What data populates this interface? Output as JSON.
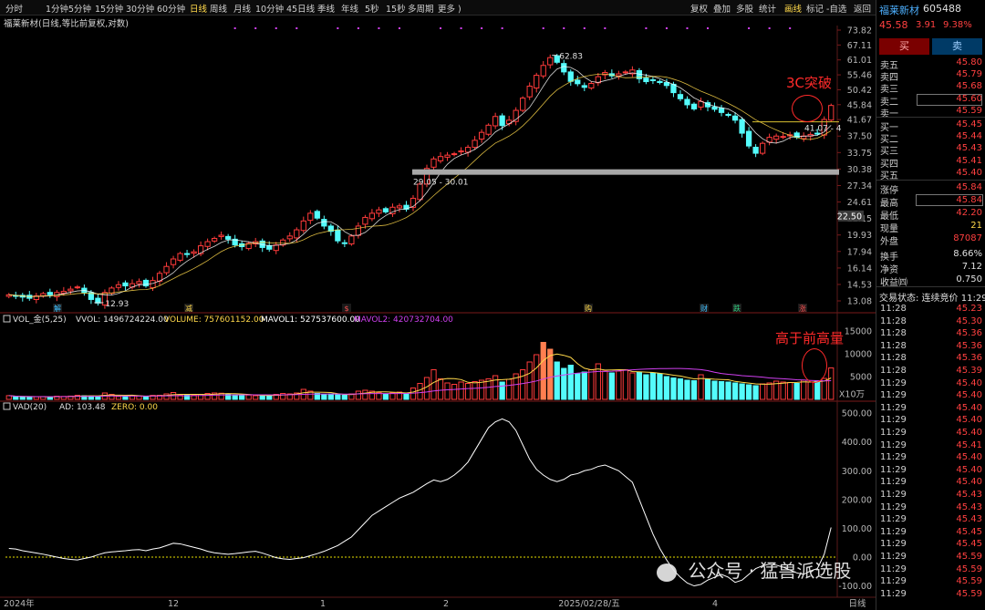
{
  "toolbar": {
    "periods": [
      "分时",
      "1分钟",
      "5分钟",
      "15分钟",
      "30分钟",
      "60分钟",
      "日线",
      "周线",
      "月线",
      "10分钟",
      "45日线",
      "季线",
      "年线",
      "5秒",
      "15秒",
      "多周期",
      "更多 )"
    ],
    "active": "日线",
    "right_items": [
      "复权",
      "叠加",
      "多股",
      "统计",
      "画线",
      "标记",
      "-自选",
      "返回"
    ],
    "active_right": "画线"
  },
  "chart_title": "福莱新材(日线,等比前复权,对数)",
  "colors": {
    "up": "#ff3b3b",
    "down": "#54fcfc",
    "ma5": "#ffffff",
    "ma10": "#ffd84a",
    "vol_ma1": "#ffd84a",
    "vol_ma2": "#d040f0",
    "vad": "#ffffff",
    "zero": "#e8e000"
  },
  "chart_data": [
    {
      "type": "candlestick",
      "y_scale": "log",
      "y_ticks": [
        "73.82",
        "67.11",
        "61.01",
        "55.46",
        "50.42",
        "45.84",
        "41.67",
        "37.50",
        "33.75",
        "30.38",
        "27.34",
        "24.61",
        "22.15",
        "19.93",
        "17.94",
        "16.14",
        "14.53",
        "13.08"
      ],
      "current_price_tag": "22.50",
      "annotations": [
        "62.83",
        "12.93",
        "29.05 - 30.01",
        "41.07 - 4"
      ],
      "x_labels": [
        "2024年",
        "12",
        "1",
        "2",
        "2025/02/28/五",
        "4",
        "日线"
      ],
      "event_markers": [
        "解",
        "减",
        "$",
        "购",
        "财",
        "跌",
        "涨"
      ],
      "close": [
        13.6,
        13.5,
        13.4,
        13.3,
        13.5,
        13.7,
        13.6,
        13.8,
        13.9,
        14.1,
        14.3,
        13.8,
        13.2,
        12.9,
        13.8,
        14.2,
        14.5,
        14.4,
        14.6,
        14.8,
        14.4,
        14.9,
        15.6,
        16.3,
        17.1,
        17.7,
        17.6,
        17.9,
        18.6,
        19.1,
        19.5,
        19.9,
        19.4,
        18.7,
        18.5,
        18.9,
        19.1,
        18.4,
        18.2,
        18.7,
        19.3,
        19.8,
        20.6,
        21.8,
        22.9,
        22.2,
        21.1,
        20.4,
        19.2,
        18.9,
        19.8,
        21.1,
        22.3,
        22.9,
        23.4,
        23.1,
        23.8,
        24.0,
        23.5,
        25.2,
        27.6,
        30.5,
        32.4,
        32.9,
        33.2,
        33.5,
        34.1,
        34.9,
        36.5,
        38.4,
        40.2,
        42.5,
        40.1,
        41.5,
        44.2,
        47.8,
        51.6,
        55.3,
        58.9,
        61.9,
        60.1,
        56.5,
        53.2,
        52.4,
        51.2,
        52.5,
        54.8,
        56.3,
        55.1,
        55.8,
        56.5,
        57.2,
        54.1,
        53.1,
        53.6,
        52.8,
        51.8,
        49.5,
        47.6,
        45.8,
        44.6,
        46.8,
        45.2,
        44.5,
        43.6,
        42.8,
        41.5,
        38.2,
        35.2,
        33.6,
        35.8,
        37.2,
        37.5,
        37.4,
        37.8,
        37.2,
        37.5,
        37.9,
        38.2,
        41.7,
        45.6
      ],
      "volume_hint": "VOL_金(5,25) VVOL: 1496724224.00"
    },
    {
      "type": "bar",
      "name": "VOL",
      "legend": [
        {
          "label": "VOL_金(5,25)",
          "color": "#e0e0e0"
        },
        {
          "label": "VVOL: 1496724224.00",
          "color": "#e0e0e0"
        },
        {
          "label": "VOLUME: 757601152.00",
          "color": "#ffd84a"
        },
        {
          "label": "MAVOL1: 527537600.00",
          "color": "#ffffff"
        },
        {
          "label": "MAVOL2: 420732704.00",
          "color": "#d040f0"
        }
      ],
      "y_ticks": [
        "15000",
        "10000",
        "5000",
        "X10万"
      ],
      "values": [
        820,
        600,
        540,
        500,
        560,
        620,
        480,
        700,
        650,
        720,
        900,
        800,
        760,
        680,
        1400,
        1100,
        640,
        700,
        820,
        760,
        600,
        880,
        900,
        1200,
        1500,
        1000,
        900,
        950,
        1100,
        1300,
        1400,
        1350,
        1200,
        1000,
        900,
        950,
        800,
        760,
        850,
        1100,
        1300,
        1200,
        1400,
        2200,
        1800,
        1300,
        1000,
        1200,
        1000,
        900,
        1200,
        1800,
        2000,
        1800,
        1500,
        1200,
        1400,
        1600,
        1300,
        2500,
        3500,
        4800,
        6500,
        4500,
        3600,
        3300,
        3800,
        3500,
        3900,
        4200,
        4500,
        5200,
        3800,
        4400,
        5600,
        6500,
        8200,
        9800,
        12500,
        11000,
        8200,
        6800,
        7500,
        5600,
        6000,
        6500,
        7800,
        6200,
        5800,
        6200,
        6500,
        5800,
        6000,
        5400,
        5800,
        5600,
        5000,
        4700,
        4500,
        4200,
        4100,
        5400,
        4400,
        4000,
        3900,
        3800,
        3600,
        3400,
        3200,
        3000,
        3400,
        3600,
        4000,
        3800,
        3700,
        3500,
        4200,
        3800,
        4000,
        4600,
        6900
      ]
    },
    {
      "type": "line",
      "name": "VAD",
      "legend": [
        {
          "label": "VAD(20)",
          "color": "#e0e0e0"
        },
        {
          "label": "AD: 103.48",
          "color": "#e0e0e0"
        },
        {
          "label": "ZERO: 0.00",
          "color": "#ffd84a"
        }
      ],
      "y_ticks": [
        "500.00",
        "400.00",
        "300.00",
        "200.00",
        "100.00",
        "0.00",
        "-100.00"
      ],
      "values": [
        30,
        28,
        22,
        18,
        14,
        10,
        5,
        0,
        -5,
        -8,
        -10,
        -5,
        0,
        8,
        15,
        18,
        20,
        22,
        25,
        26,
        22,
        28,
        32,
        40,
        48,
        46,
        40,
        34,
        28,
        20,
        15,
        12,
        10,
        12,
        15,
        18,
        20,
        14,
        6,
        -2,
        -6,
        -8,
        -5,
        -2,
        5,
        12,
        20,
        30,
        40,
        55,
        70,
        95,
        120,
        145,
        160,
        175,
        190,
        205,
        215,
        225,
        240,
        255,
        268,
        262,
        270,
        285,
        305,
        330,
        370,
        410,
        450,
        470,
        480,
        470,
        440,
        390,
        340,
        305,
        285,
        270,
        262,
        270,
        285,
        290,
        300,
        305,
        315,
        320,
        310,
        300,
        280,
        260,
        200,
        140,
        80,
        30,
        -10,
        -45,
        -70,
        -90,
        -100,
        -95,
        -80,
        -70,
        -60,
        -70,
        -88,
        -80,
        -60,
        -40,
        -30,
        -25,
        -28,
        -35,
        -45,
        -55,
        -60,
        -48,
        -40,
        10,
        103
      ]
    }
  ],
  "right_panel": {
    "name": "福莱新材",
    "code": "605488",
    "price": "45.58",
    "change": "3.91",
    "pct": "9.38%",
    "buy_btn": "买",
    "sell_btn": "卖",
    "asks": [
      {
        "label": "卖五",
        "price": "45.80"
      },
      {
        "label": "卖四",
        "price": "45.79"
      },
      {
        "label": "卖三",
        "price": "45.68"
      },
      {
        "label": "卖二",
        "price": "45.60"
      },
      {
        "label": "卖一",
        "price": "45.59"
      }
    ],
    "bids": [
      {
        "label": "买一",
        "price": "45.45"
      },
      {
        "label": "买二",
        "price": "45.44"
      },
      {
        "label": "买三",
        "price": "45.43"
      },
      {
        "label": "买四",
        "price": "45.41"
      },
      {
        "label": "买五",
        "price": "45.40"
      }
    ],
    "stats": [
      {
        "label": "涨停",
        "value": "45.84",
        "cls": "red"
      },
      {
        "label": "最高",
        "value": "45.84",
        "cls": "red"
      },
      {
        "label": "最低",
        "value": "42.20",
        "cls": "red"
      },
      {
        "label": "现量",
        "value": "21",
        "cls": "yellow"
      },
      {
        "label": "外盘",
        "value": "87087",
        "cls": "red"
      },
      {
        "label": "换手",
        "value": "8.66%",
        "cls": "white"
      },
      {
        "label": "净资",
        "value": "7.12",
        "cls": "white"
      },
      {
        "label": "收益㈣",
        "value": "0.750",
        "cls": "white"
      }
    ],
    "status_label": "交易状态: 连续竞价 11:29",
    "ticks": [
      {
        "t": "11:28",
        "p": "45.23"
      },
      {
        "t": "11:28",
        "p": "45.30"
      },
      {
        "t": "11:28",
        "p": "45.36"
      },
      {
        "t": "11:28",
        "p": "45.36"
      },
      {
        "t": "11:28",
        "p": "45.36"
      },
      {
        "t": "11:28",
        "p": "45.39"
      },
      {
        "t": "11:29",
        "p": "45.40"
      },
      {
        "t": "11:29",
        "p": "45.40"
      },
      {
        "t": "11:29",
        "p": "45.40"
      },
      {
        "t": "11:29",
        "p": "45.40"
      },
      {
        "t": "11:29",
        "p": "45.40"
      },
      {
        "t": "11:29",
        "p": "45.41"
      },
      {
        "t": "11:29",
        "p": "45.40"
      },
      {
        "t": "11:29",
        "p": "45.40"
      },
      {
        "t": "11:29",
        "p": "45.40"
      },
      {
        "t": "11:29",
        "p": "45.43"
      },
      {
        "t": "11:29",
        "p": "45.43"
      },
      {
        "t": "11:29",
        "p": "45.43"
      },
      {
        "t": "11:29",
        "p": "45.45"
      },
      {
        "t": "11:29",
        "p": "45.45"
      },
      {
        "t": "11:29",
        "p": "45.59"
      },
      {
        "t": "11:29",
        "p": "45.59"
      },
      {
        "t": "11:29",
        "p": "45.59"
      },
      {
        "t": "11:29",
        "p": "45.59"
      }
    ]
  },
  "annotations": {
    "breakout": "3C突破",
    "volume_note": "高于前高量"
  },
  "watermark": "公众号 · 猛兽派选股"
}
